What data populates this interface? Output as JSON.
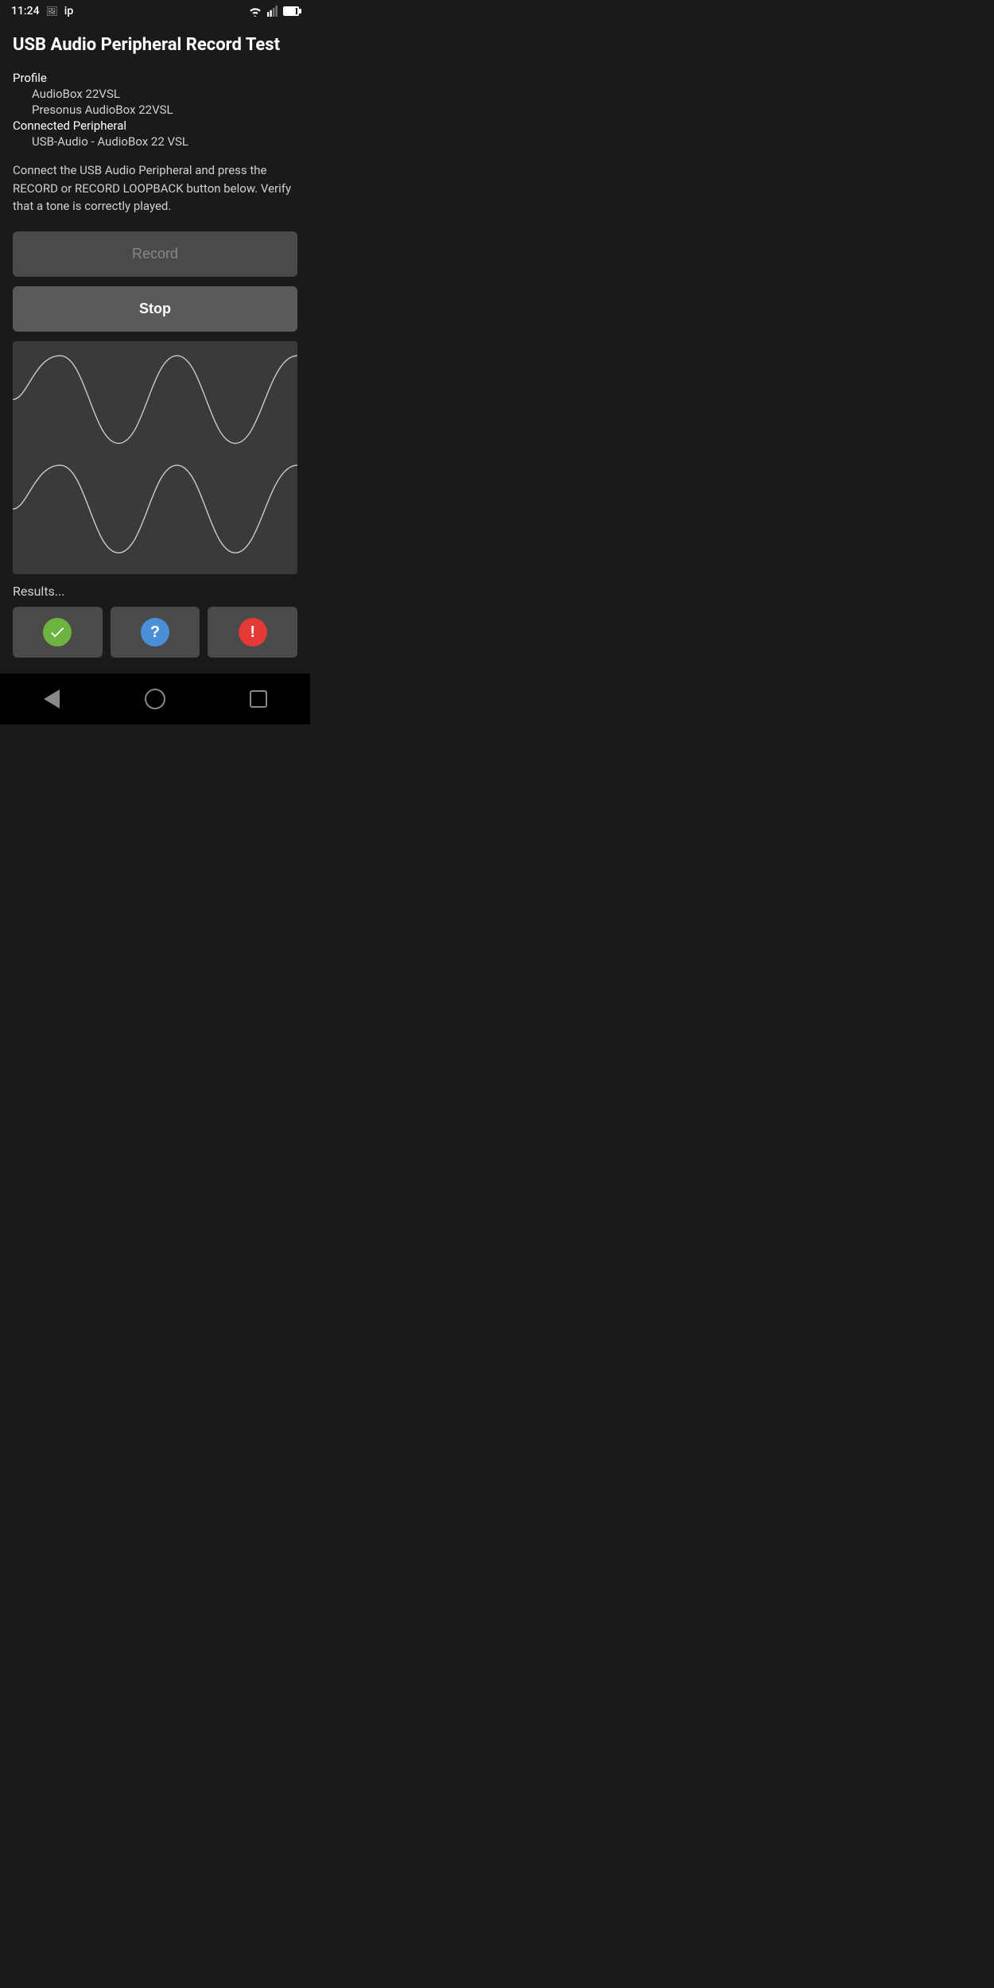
{
  "statusBar": {
    "time": "11:24",
    "icons": [
      "image",
      "ip"
    ],
    "colors": {
      "background": "#1a1a1a",
      "text": "#ffffff"
    }
  },
  "header": {
    "title": "USB Audio Peripheral Record Test"
  },
  "profile": {
    "label": "Profile",
    "line1": "AudioBox 22VSL",
    "line2": "Presonus AudioBox 22VSL"
  },
  "connected": {
    "label": "Connected Peripheral",
    "value": "USB-Audio - AudioBox 22 VSL"
  },
  "description": "Connect the USB Audio Peripheral and press the RECORD or RECORD LOOPBACK button below. Verify that a tone is correctly played.",
  "buttons": {
    "record": "Record",
    "stop": "Stop"
  },
  "results": {
    "label": "Results...",
    "buttons": {
      "check": "✓",
      "question": "?",
      "exclamation": "!"
    }
  },
  "navbar": {
    "back": "back",
    "home": "home",
    "recent": "recent"
  }
}
